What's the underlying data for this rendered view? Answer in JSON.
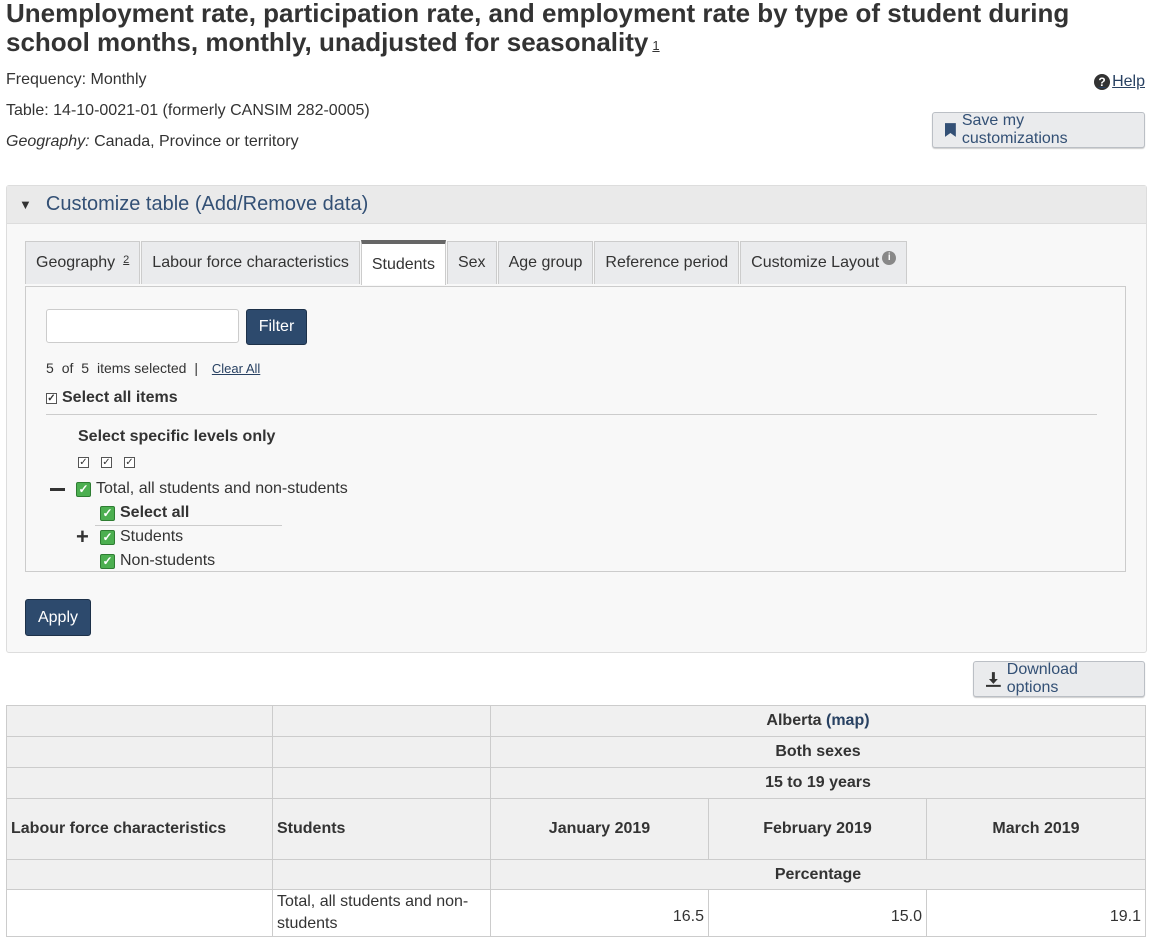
{
  "page": {
    "title": "Unemployment rate, participation rate, and employment rate by type of student during school months, monthly, unadjusted for seasonality",
    "title_footnote": "1",
    "frequency": "Frequency: Monthly",
    "table_id": "Table: 14-10-0021-01 (formerly CANSIM 282-0005)",
    "geography_label": "Geography:",
    "geography_value": "Canada, Province or territory",
    "help_label": "Help",
    "save_label": "Save my customizations"
  },
  "customize": {
    "heading": "Customize table (Add/Remove data)",
    "tabs": [
      {
        "label": "Geography",
        "footnote": "2"
      },
      {
        "label": "Labour force characteristics"
      },
      {
        "label": "Students",
        "active": true
      },
      {
        "label": "Sex"
      },
      {
        "label": "Age group"
      },
      {
        "label": "Reference period"
      },
      {
        "label": "Customize Layout"
      }
    ],
    "filter_label": "Filter",
    "filter_value": "",
    "selected_count": "5",
    "of_label": "of",
    "total_count": "5",
    "items_selected_label": "items selected",
    "separator": "|",
    "clear_all_label": "Clear All",
    "select_all_items_label": "Select all items",
    "specific_levels_label": "Select specific levels only",
    "tree": {
      "root_label": "Total, all students and non-students",
      "select_all_label": "Select all",
      "students_label": "Students",
      "non_students_label": "Non-students"
    },
    "apply_label": "Apply"
  },
  "download_label": "Download options",
  "table": {
    "geo": "Alberta",
    "map_link": "(map)",
    "sex": "Both sexes",
    "age": "15 to 19 years",
    "col_lfc": "Labour force characteristics",
    "col_students": "Students",
    "months": [
      "January 2019",
      "February 2019",
      "March 2019"
    ],
    "unit": "Percentage",
    "rows": [
      {
        "lfc": "",
        "students": "Total, all students and non-students",
        "values": [
          "16.5",
          "15.0",
          "19.1"
        ]
      }
    ]
  }
}
